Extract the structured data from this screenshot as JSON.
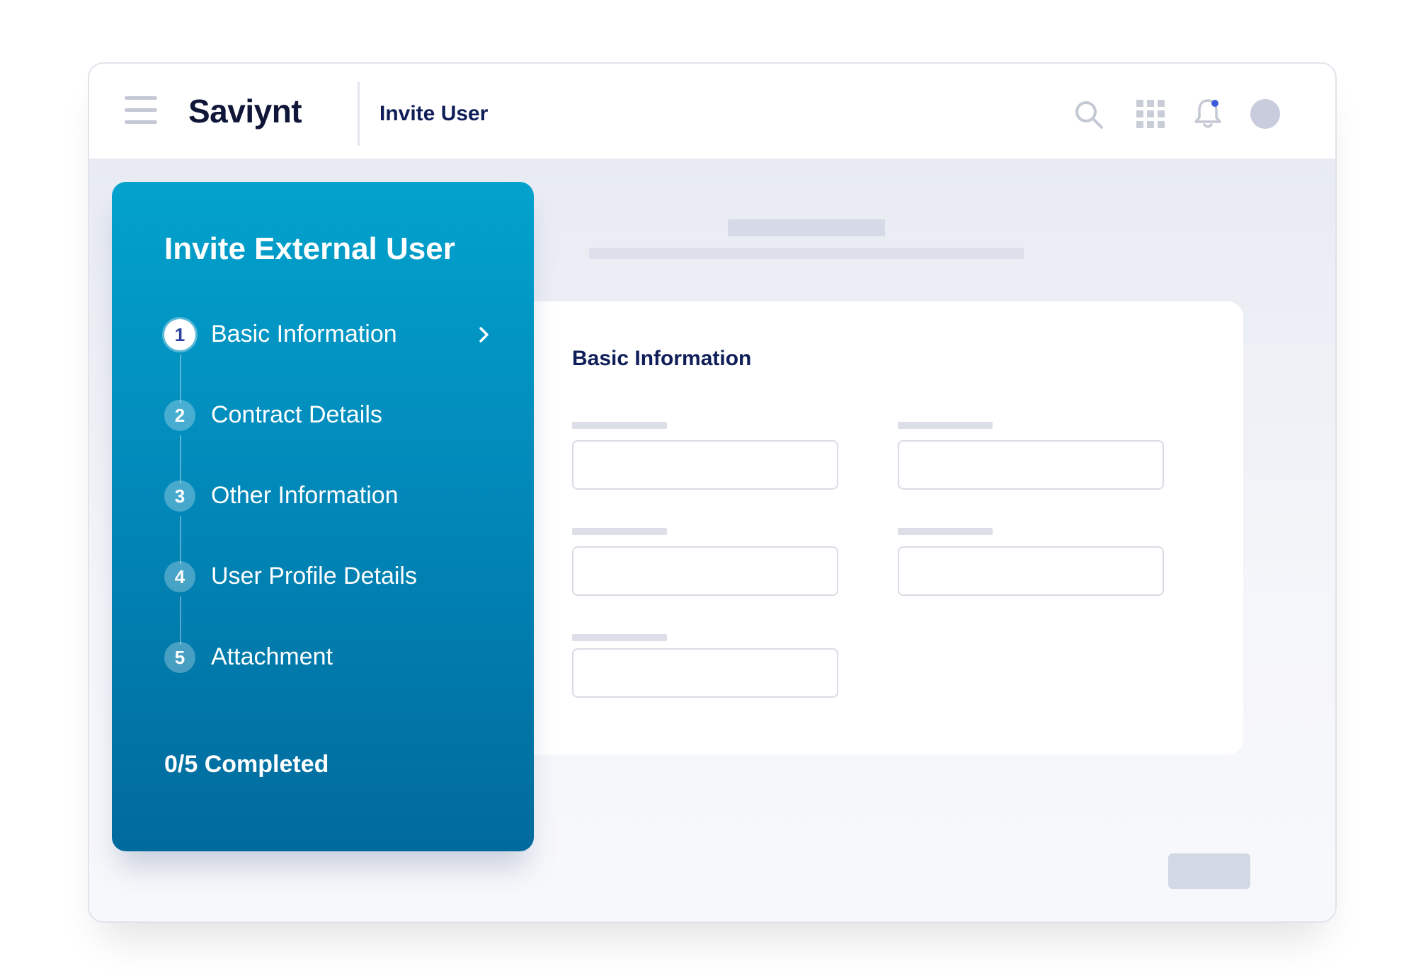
{
  "header": {
    "logo": "Saviynt",
    "page_title": "Invite User",
    "icons": [
      "menu-icon",
      "search-icon",
      "apps-grid-icon",
      "bell-icon",
      "avatar"
    ]
  },
  "stepper": {
    "title": "Invite External User",
    "steps": [
      {
        "number": "1",
        "label": "Basic Information",
        "active": true
      },
      {
        "number": "2",
        "label": "Contract Details",
        "active": false
      },
      {
        "number": "3",
        "label": "Other Information",
        "active": false
      },
      {
        "number": "4",
        "label": "User Profile Details",
        "active": false
      },
      {
        "number": "5",
        "label": "Attachment",
        "active": false
      }
    ],
    "progress": "0/5 Completed"
  },
  "form": {
    "title": "Basic Information"
  },
  "colors": {
    "stepper_top": "#03a2cd",
    "stepper_bottom": "#016a9c",
    "heading": "#0f1e58",
    "notification_dot": "#3b5bdb"
  }
}
